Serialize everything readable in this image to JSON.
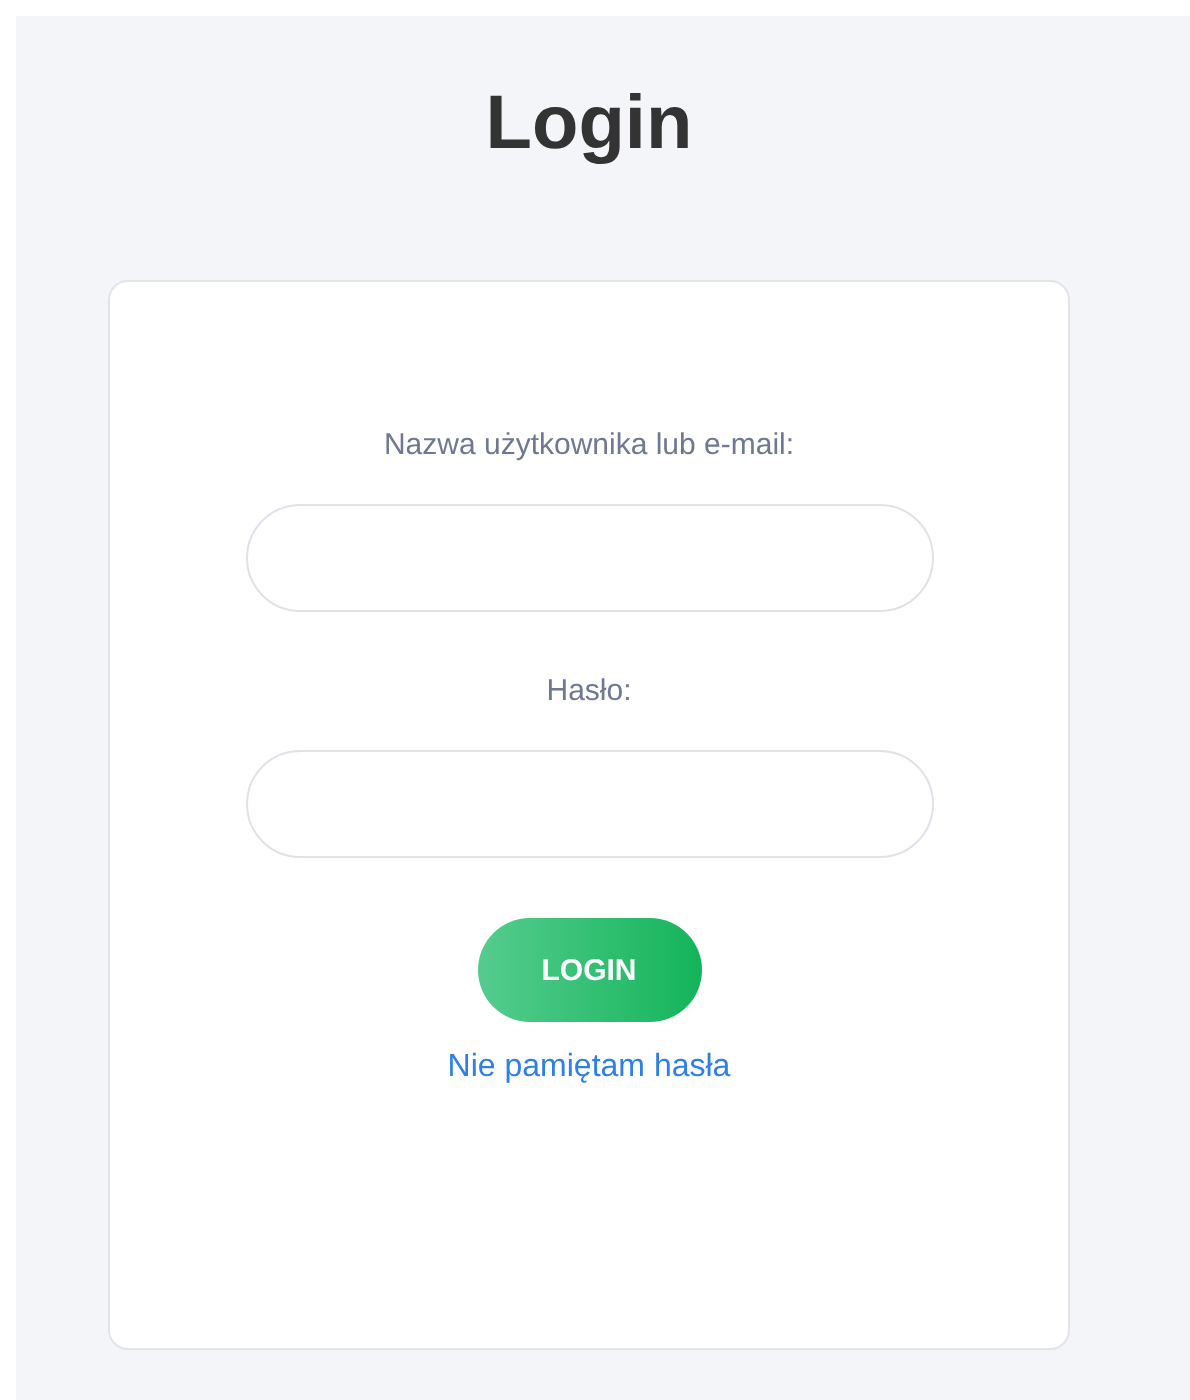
{
  "title": "Login",
  "fields": [
    {
      "label": "Nazwa użytkownika lub e-mail:"
    },
    {
      "label": "Hasło:"
    }
  ],
  "button": {
    "label": "LOGIN"
  },
  "link": {
    "label": "Nie pamiętam hasła"
  }
}
